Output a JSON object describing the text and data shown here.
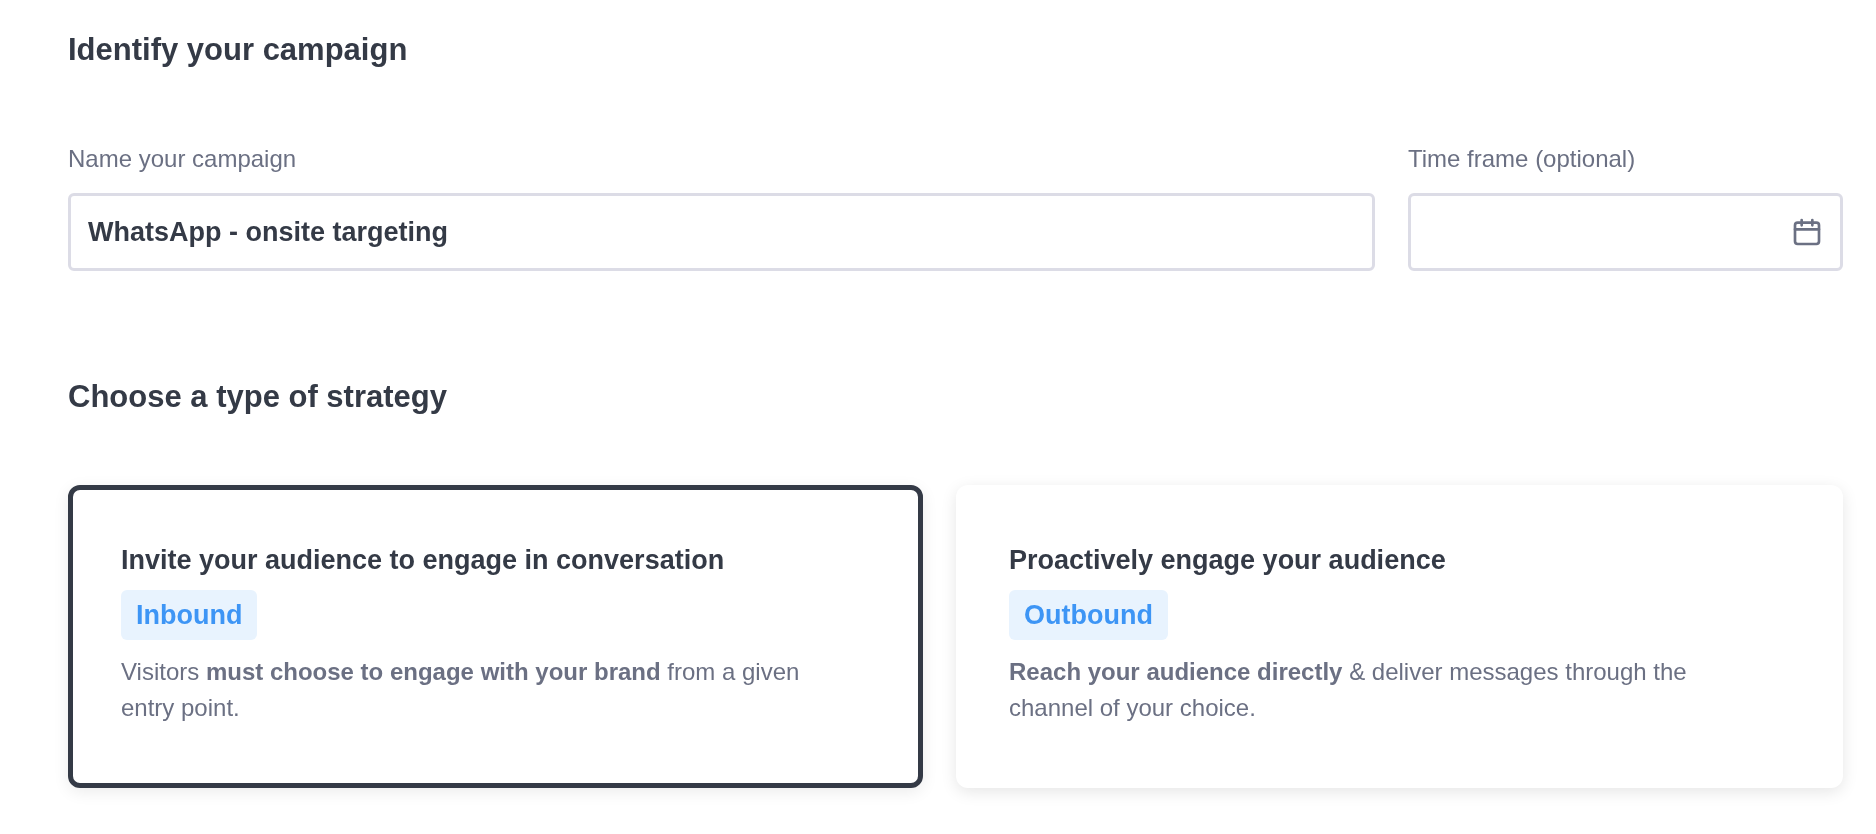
{
  "identify_section": {
    "heading": "Identify your campaign",
    "name_field": {
      "label": "Name your campaign",
      "value": "WhatsApp - onsite targeting"
    },
    "time_frame_field": {
      "label": "Time frame (optional)"
    }
  },
  "strategy_section": {
    "heading": "Choose a type of strategy",
    "cards": [
      {
        "title": "Invite your audience to engage in conversation",
        "badge": "Inbound",
        "description": "Visitors **must choose to engage with your brand** from a given entry point.",
        "selected": true
      },
      {
        "title": "Proactively engage your audience",
        "badge": "Outbound",
        "description": "**Reach your audience directly** & deliver messages through the channel of your choice.",
        "selected": false
      }
    ]
  }
}
